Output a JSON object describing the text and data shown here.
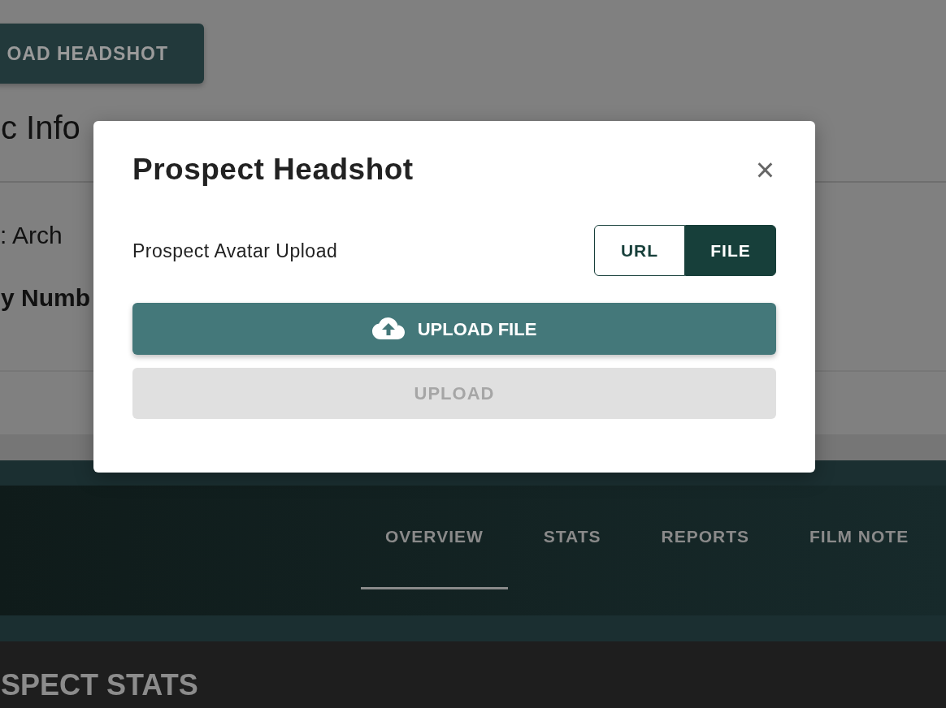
{
  "page": {
    "top_button": "OAD HEADSHOT",
    "section_title": "c Info",
    "field_1": ": Arch",
    "field_2": "y Numb",
    "tabs": [
      {
        "label": "OVERVIEW",
        "selected": true
      },
      {
        "label": "STATS",
        "selected": false
      },
      {
        "label": "REPORTS",
        "selected": false
      },
      {
        "label": "FILM NOTE",
        "selected": false
      }
    ],
    "stats_heading": "SPECT STATS"
  },
  "modal": {
    "title": "Prospect Headshot",
    "close": "×",
    "label": "Prospect Avatar Upload",
    "source_options": [
      {
        "label": "URL",
        "selected": false
      },
      {
        "label": "FILE",
        "selected": true
      }
    ],
    "file_button": "UPLOAD FILE",
    "upload_button": {
      "label": "UPLOAD",
      "disabled": true
    }
  }
}
